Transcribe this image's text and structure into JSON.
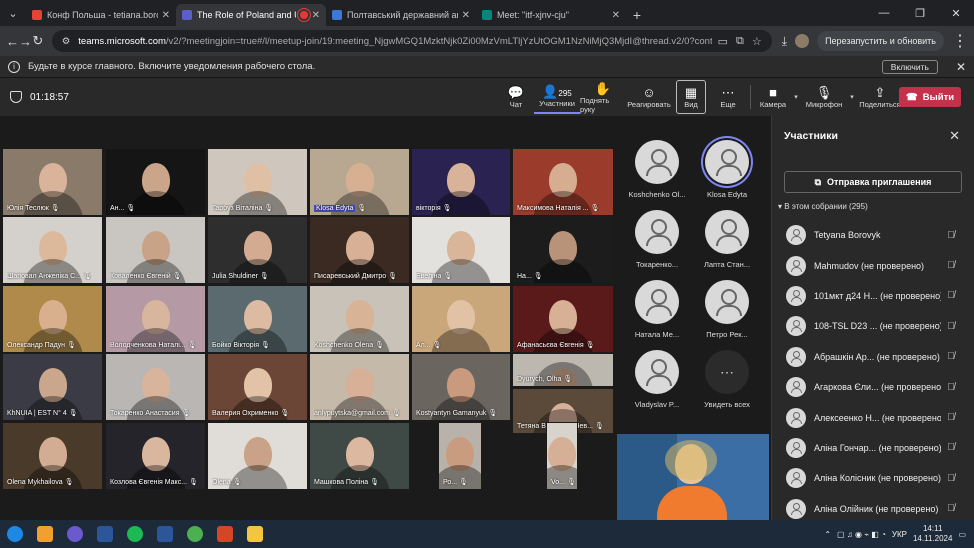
{
  "browser": {
    "tabs": [
      {
        "title": "Конф Польша - tetiana.borovyk",
        "color": "#e94235",
        "active": false
      },
      {
        "title": "The Role of Poland and Uk",
        "color": "#5b5fc7",
        "active": true,
        "recording": true
      },
      {
        "title": "Полтавський державний агра",
        "color": "#3c78d8",
        "active": false
      },
      {
        "title": "Meet: \"itf-xjnv-cju\"",
        "color": "#00897b",
        "active": false
      }
    ],
    "url_site": "teams.microsoft.com",
    "url_path": "/v2/?meetingjoin=true#/l/meetup-join/19:meeting_NjgwMGQ1MzktNjk0Zi00MzVmLTljYzUtOGM1NzNiMjQ3MjdI@thread.v2/0?context=%...",
    "relaunch_label": "Перезапустить и обновить"
  },
  "notification": {
    "text": "Будьте в курсе главного. Включите уведомления рабочего стола.",
    "enable_label": "Включить"
  },
  "meeting": {
    "timer": "01:18:57",
    "participants_count": "295",
    "toolbar": {
      "chat": "Чат",
      "participants": "Участники",
      "raise_hand": "Поднять руку",
      "react": "Реагировать",
      "view": "Вид",
      "more": "Еще",
      "camera": "Камера",
      "mic": "Микрофон",
      "share": "Поделиться",
      "leave": "Выйти"
    }
  },
  "video_tiles": [
    {
      "name": "Юлія Теслюк",
      "bg": "#8a7a6a",
      "skin": "#d9b49a"
    },
    {
      "name": "Ан...",
      "bg": "#151515",
      "skin": "#caa58a"
    },
    {
      "name": "Гарбуз Віталіна",
      "bg": "#cfc7bd",
      "skin": "#e0c0a5"
    },
    {
      "name": "Klosa Edyta",
      "bg": "#b9a891",
      "skin": "#d7b092",
      "highlight": true
    },
    {
      "name": "вікторія",
      "bg": "#2a2250",
      "skin": "#d8b39a"
    },
    {
      "name": "Максимова Наталія ...",
      "bg": "#9b3b2b",
      "skin": "#d6ad90"
    },
    {
      "name": "Шаповал Анжеліка С...",
      "bg": "#d4d0cb",
      "skin": "#ddb99c"
    },
    {
      "name": "Коваленко Євгеній",
      "bg": "#c9c6c2",
      "skin": "#c9a387"
    },
    {
      "name": "Julia Shuldiner",
      "bg": "#2e2e2e",
      "skin": "#d2ab90"
    },
    {
      "name": "Писаревський Дмитро",
      "bg": "#3a2a22",
      "skin": "#d8b095"
    },
    {
      "name": "Евеліна",
      "bg": "#e3e1de",
      "skin": "#d9b69a"
    },
    {
      "name": "На...",
      "bg": "#1c1c1c",
      "skin": "#b8937a"
    },
    {
      "name": "Олександр Падун",
      "bg": "#b08a4a",
      "skin": "#d9b08e"
    },
    {
      "name": "Володченкова Наталі...",
      "bg": "#b59aa6",
      "skin": "#d8b69e"
    },
    {
      "name": "Бойко Вікторія",
      "bg": "#5a6a6e",
      "skin": "#dcbba2"
    },
    {
      "name": "Koshchenko Olena",
      "bg": "#c8c2b8",
      "skin": "#d9b395"
    },
    {
      "name": "Ал...",
      "bg": "#c9a77a",
      "skin": "#e2c2a5"
    },
    {
      "name": "Афанасьєва Євгенія",
      "bg": "#5a1a1a",
      "skin": "#d7b096"
    },
    {
      "name": "KhNUIA | EST N° 4",
      "bg": "#3b3b45",
      "skin": "#caa68c"
    },
    {
      "name": "Токаренко Анастасия",
      "bg": "#b9b6b4",
      "skin": "#d8b49c"
    },
    {
      "name": "Валерия Охрименко",
      "bg": "#6b4535",
      "skin": "#e2c3a8"
    },
    {
      "name": "anlypuytska@gmail.com",
      "bg": "#c5b9a9",
      "skin": "#d8b098"
    },
    {
      "name": "Kostyantyn Gamanyuk",
      "bg": "#6b6560",
      "skin": "#c99a7e"
    },
    {
      "name": "Dyurych, Olha",
      "bg": "#bcb7af",
      "skin": "#d5ad92"
    },
    {
      "name": "Тетяна Воронько-Нев...",
      "bg": "#5b4a3a",
      "skin": "#d7b09a"
    },
    {
      "name": "Olena Mykhailova",
      "bg": "#4a3a2a",
      "skin": "#d2ad93"
    },
    {
      "name": "Козлова Євгенія Макс...",
      "bg": "#24242a",
      "skin": "#d9b69e"
    },
    {
      "name": "Olena",
      "bg": "#e0ddd8",
      "skin": "#caa287"
    },
    {
      "name": "Машкова Поліна",
      "bg": "#3f4a46",
      "skin": "#dcb8a0"
    },
    {
      "name": "Ро...",
      "bg": "#b8b2aa",
      "skin": "#c99c80"
    },
    {
      "name": "Vo...",
      "bg": "#d8d3cc",
      "skin": "#d5b096"
    }
  ],
  "avatar_tiles": [
    {
      "name": "Koshchenko Ol..."
    },
    {
      "name": "Klosa Edyta"
    },
    {
      "name": "Токаренко..."
    },
    {
      "name": "Лапта Стан..."
    },
    {
      "name": "Натала Ме..."
    },
    {
      "name": "Петро Рек..."
    },
    {
      "name": "Vladyslav P..."
    },
    {
      "name": "Увидеть всех"
    }
  ],
  "panel": {
    "title": "Участники",
    "invite_label": "Отправка приглашения",
    "section_label": "В этом собрании (295)",
    "people": [
      "Tetyana Borovyk",
      "Mahmudov (не проверено)",
      "101мкт д24 Н... (не проверено)",
      "108-TSL D23 ... (не проверено)",
      "Абрашкін Ар... (не проверено)",
      "Агаркова Єли... (не проверено)",
      "Алексеенко Н... (не проверено)",
      "Аліна Гончар... (не проверено)",
      "Аліна Колісник (не проверено)",
      "Аліна Олійник (не проверено)"
    ]
  },
  "taskbar": {
    "lang": "УКР",
    "time": "14:11",
    "date": "14.11.2024",
    "apps": [
      {
        "name": "start",
        "color": "#1e88e5"
      },
      {
        "name": "app-orange",
        "color": "#f0a030"
      },
      {
        "name": "app-globe",
        "color": "#6a5acd"
      },
      {
        "name": "word",
        "color": "#2b579a"
      },
      {
        "name": "app-green",
        "color": "#1db954"
      },
      {
        "name": "word-2",
        "color": "#2b579a"
      },
      {
        "name": "chrome",
        "color": "#4caf50"
      },
      {
        "name": "powerpoint",
        "color": "#d24726"
      },
      {
        "name": "explorer",
        "color": "#f4c542"
      }
    ]
  }
}
